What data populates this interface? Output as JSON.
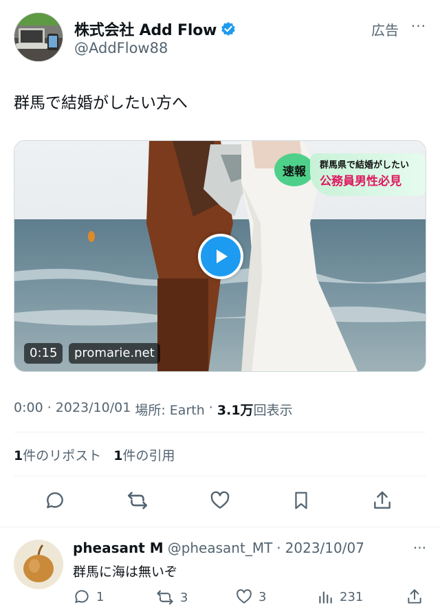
{
  "post": {
    "account_name": "株式会社 Add Flow",
    "handle": "@AddFlow88",
    "ad_label": "広告",
    "more": "···",
    "text": "群馬で結婚がしたい方へ",
    "video": {
      "duration": "0:15",
      "domain": "promarie.net",
      "overlay_badge": "速報",
      "overlay_line1": "群馬県で結婚がしたい",
      "overlay_line2": "公務員男性必見"
    },
    "meta": {
      "time": "0:00",
      "date": "2023/10/01",
      "location_label": "場所: Earth",
      "views_count": "3.1万",
      "views_label": "回表示"
    },
    "stats": {
      "reposts_count": "1",
      "reposts_label": "件のリポスト",
      "quotes_count": "1",
      "quotes_label": "件の引用"
    }
  },
  "reply": {
    "name": "pheasant M",
    "handle": "@pheasant_MT",
    "date": "2023/10/07",
    "more": "···",
    "text": "群馬に海は無いぞ",
    "replies": "1",
    "reposts": "3",
    "likes": "3",
    "views": "231"
  },
  "colors": {
    "accent": "#1d9bf0",
    "muted": "#536471",
    "text": "#0f1419",
    "overlay_pink": "#e0165f",
    "overlay_green": "#4fd08a"
  }
}
